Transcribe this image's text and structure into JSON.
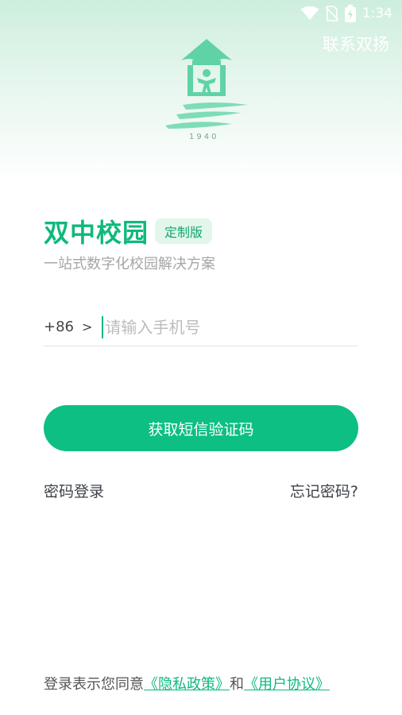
{
  "status_bar": {
    "time": "1:34",
    "icons": [
      "wifi-icon",
      "no-sim-icon",
      "battery-charging-icon"
    ]
  },
  "header": {
    "contact_label": "联系双扬",
    "logo_year": "1940"
  },
  "app": {
    "title": "双中校园",
    "edition_badge": "定制版",
    "subtitle": "一站式数字化校园解决方案"
  },
  "phone": {
    "country_code": "+86",
    "chevron": ">",
    "placeholder": "请输入手机号",
    "value": ""
  },
  "actions": {
    "get_code_label": "获取短信验证码",
    "password_login_label": "密码登录",
    "forgot_password_label": "忘记密码?"
  },
  "agreement": {
    "prefix": "登录表示您同意",
    "privacy_label": "《隐私政策》",
    "conjunction": "和",
    "terms_label": "《用户协议》"
  },
  "colors": {
    "accent": "#0dbf83",
    "title": "#0fb97c",
    "badge_bg": "#e3f6ec"
  }
}
